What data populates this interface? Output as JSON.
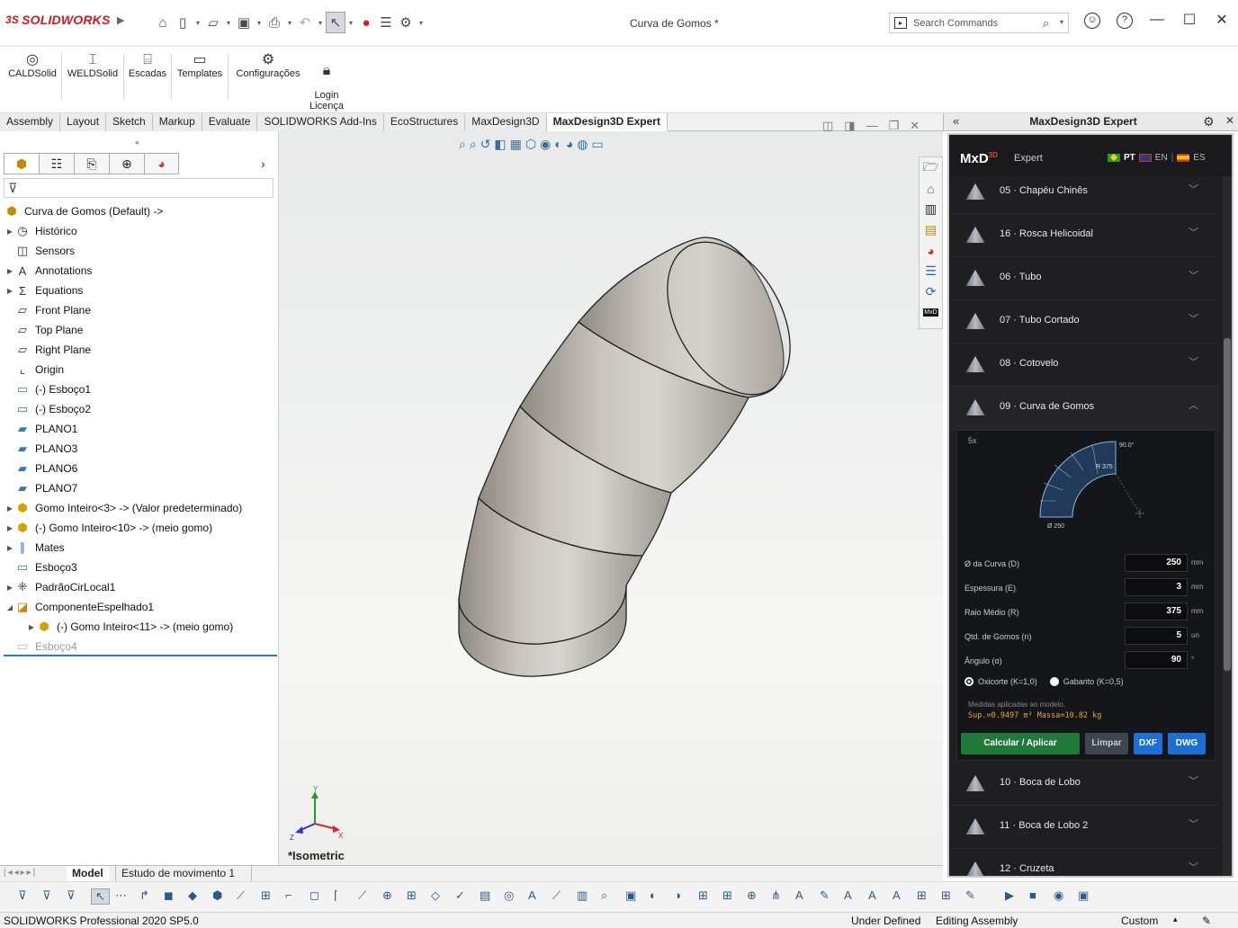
{
  "titlebar": {
    "brand_prefix": "3S",
    "brand": "SOLIDWORKS",
    "document_title": "Curva de Gomos *",
    "search_placeholder": "Search Commands"
  },
  "ribbon": [
    {
      "id": "caldsolid",
      "label": "CALDSolid"
    },
    {
      "id": "weldsolid",
      "label": "WELDSolid"
    },
    {
      "id": "escadas",
      "label": "Escadas"
    },
    {
      "id": "templates",
      "label": "Templates"
    },
    {
      "id": "configuracoes",
      "label": "Configurações"
    },
    {
      "id": "login",
      "label": "Login\nLicença"
    }
  ],
  "tabs": [
    "Assembly",
    "Layout",
    "Sketch",
    "Markup",
    "Evaluate",
    "SOLIDWORKS Add-Ins",
    "EcoStructures",
    "MaxDesign3D",
    "MaxDesign3D Expert"
  ],
  "active_tab": "MaxDesign3D Expert",
  "tree": {
    "root": "Curva de Gomos  (Default) ->",
    "nodes": [
      {
        "label": "Histórico",
        "expand": true,
        "icon": "history-icon"
      },
      {
        "label": "Sensors",
        "expand": false,
        "icon": "sensor-icon"
      },
      {
        "label": "Annotations",
        "expand": true,
        "icon": "annotation-icon"
      },
      {
        "label": "Equations",
        "expand": true,
        "icon": "equation-icon"
      },
      {
        "label": "Front Plane",
        "expand": false,
        "icon": "plane-icon"
      },
      {
        "label": "Top Plane",
        "expand": false,
        "icon": "plane-icon"
      },
      {
        "label": "Right Plane",
        "expand": false,
        "icon": "plane-icon"
      },
      {
        "label": "Origin",
        "expand": false,
        "icon": "origin-icon"
      },
      {
        "label": "(-) Esboço1",
        "expand": false,
        "icon": "sketch-icon"
      },
      {
        "label": "(-) Esboço2",
        "expand": false,
        "icon": "sketch-icon"
      },
      {
        "label": "PLANO1",
        "expand": false,
        "icon": "plane-blue-icon"
      },
      {
        "label": "PLANO3",
        "expand": false,
        "icon": "plane-blue-icon"
      },
      {
        "label": "PLANO6",
        "expand": false,
        "icon": "plane-blue-icon"
      },
      {
        "label": "PLANO7",
        "expand": false,
        "icon": "plane-blue-icon"
      },
      {
        "label": "Gomo Inteiro<3> -> (Valor predeterminado)",
        "expand": true,
        "icon": "part-icon"
      },
      {
        "label": "(-) Gomo Inteiro<10> -> (meio gomo)",
        "expand": true,
        "icon": "part-icon"
      },
      {
        "label": "Mates",
        "expand": true,
        "icon": "mates-icon"
      },
      {
        "label": "Esboço3",
        "expand": false,
        "icon": "sketch-icon"
      },
      {
        "label": "PadrãoCirLocal1",
        "expand": true,
        "icon": "pattern-icon"
      },
      {
        "label": "ComponenteEspelhado1",
        "expand": "open",
        "icon": "mirror-icon"
      },
      {
        "label": "(-) Gomo Inteiro<11> -> (meio gomo)",
        "expand": true,
        "icon": "part-icon",
        "indent": true
      },
      {
        "label": "Esboço4",
        "expand": false,
        "icon": "sketch-icon",
        "dim": true
      }
    ]
  },
  "viewport": {
    "view_label": "*Isometric",
    "triad": {
      "y": "Y",
      "x": "X",
      "z": "Z"
    }
  },
  "panel": {
    "header": "MaxDesign3D Expert",
    "brand": "MxD",
    "brand_sup": "3D",
    "subtitle": "Expert",
    "languages": [
      {
        "code": "PT",
        "active": true
      },
      {
        "code": "EN",
        "active": false
      },
      {
        "code": "ES",
        "active": false
      }
    ],
    "items": [
      {
        "label": "05 · Chapéu Chinês",
        "open": false
      },
      {
        "label": "16 · Rosca Helicoidal",
        "open": false
      },
      {
        "label": "06 · Tubo",
        "open": false
      },
      {
        "label": "07 · Tubo Cortado",
        "open": false
      },
      {
        "label": "08 · Cotovelo",
        "open": false
      },
      {
        "label": "09 · Curva de Gomos",
        "open": true
      }
    ],
    "items_after": [
      {
        "label": "10 · Boca de Lobo",
        "open": false
      },
      {
        "label": "11 · Boca de Lobo 2",
        "open": false
      },
      {
        "label": "12 · Cruzeta",
        "open": false
      }
    ],
    "diagram": {
      "count_label": "5x",
      "angle_label": "90.0°",
      "radius_label": "R 375",
      "diameter_label": "Ø 250"
    },
    "fields": [
      {
        "label": "Ø da Curva (D)",
        "value": "250",
        "unit": "mm"
      },
      {
        "label": "Espessura (E)",
        "value": "3",
        "unit": "mm"
      },
      {
        "label": "Raio Médio (R)",
        "value": "375",
        "unit": "mm"
      },
      {
        "label": "Qtd. de Gomos (n)",
        "value": "5",
        "unit": "un"
      },
      {
        "label": "Ângulo (α)",
        "value": "90",
        "unit": "°"
      }
    ],
    "radios": [
      {
        "label": "Oxicorte (K=1,0)",
        "checked": true
      },
      {
        "label": "Gabarito (K=0,5)",
        "checked": false
      }
    ],
    "note": "Medidas aplicadas ao modelo.",
    "stats": "Sup.=0.9497 m²   Massa=10.82 kg",
    "buttons": {
      "calc": "Calcular / Aplicar",
      "clear": "Limpar",
      "dxf": "DXF",
      "dwg": "DWG"
    }
  },
  "bottom_tabs": [
    "Model",
    "Estudo de movimento 1"
  ],
  "status": {
    "product": "SOLIDWORKS Professional 2020 SP5.0",
    "state": "Under Defined",
    "mode": "Editing Assembly",
    "units": "Custom"
  },
  "colors": {
    "accent": "#1f7a3a",
    "link": "#1d6fd6",
    "panel_bg": "#1f1f22",
    "stats": "#e8a33a"
  }
}
